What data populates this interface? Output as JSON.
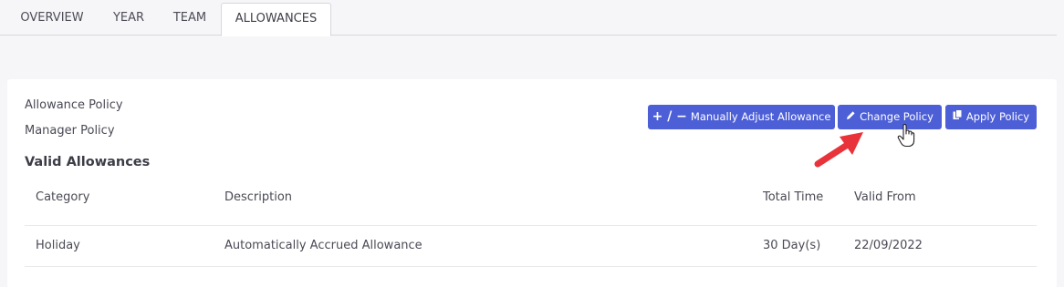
{
  "tabs": [
    {
      "label": "OVERVIEW"
    },
    {
      "label": "YEAR"
    },
    {
      "label": "TEAM"
    },
    {
      "label": "ALLOWANCES",
      "active": true
    }
  ],
  "policies": {
    "allowance_policy": "Allowance Policy",
    "manager_policy": "Manager Policy"
  },
  "section_title": "Valid Allowances",
  "buttons": {
    "adjust": {
      "icon": "plus-minus-icon",
      "icon_text": "+ / −",
      "label": "Manually Adjust Allowance"
    },
    "change": {
      "icon": "pencil-icon",
      "label": "Change Policy"
    },
    "apply": {
      "icon": "copy-icon",
      "label": "Apply Policy"
    }
  },
  "table": {
    "headers": [
      "Category",
      "Description",
      "Total Time",
      "Valid From"
    ],
    "rows": [
      [
        "Holiday",
        "Automatically Accrued Allowance",
        "30 Day(s)",
        "22/09/2022"
      ]
    ]
  },
  "colors": {
    "accent": "#4d5fd6",
    "annotation_arrow": "#e8333a"
  }
}
